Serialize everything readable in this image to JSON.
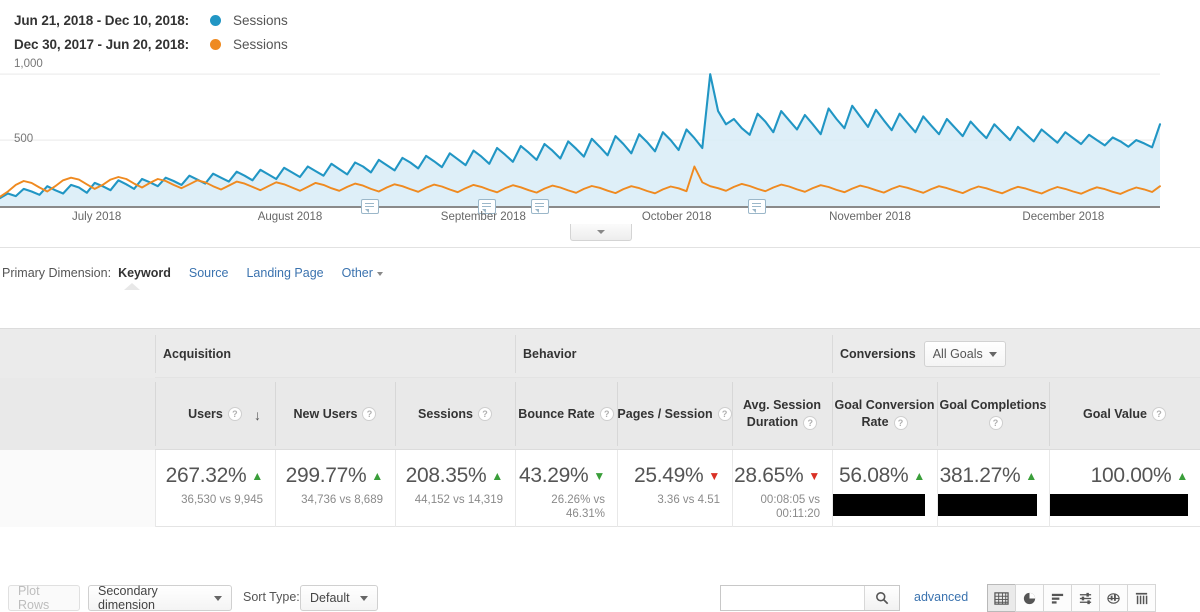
{
  "legend": {
    "rows": [
      {
        "range": "Jun 21, 2018 - Dec 10, 2018:",
        "metric": "Sessions",
        "color": "#2196c4"
      },
      {
        "range": "Dec 30, 2017 - Jun 20, 2018:",
        "metric": "Sessions",
        "color": "#ef8a20"
      }
    ]
  },
  "chart_data": {
    "type": "line",
    "title": "",
    "xlabel": "",
    "ylabel": "Sessions",
    "ylim": [
      0,
      1100
    ],
    "yticks": [
      "1,000",
      "500"
    ],
    "ytick_values": [
      1000,
      500
    ],
    "grid": true,
    "legend_position": "top-left",
    "categories": [
      "July 2018",
      "August 2018",
      "September 2018",
      "October 2018",
      "November 2018",
      "December 2018"
    ],
    "xtick_labels": [
      "July 2018",
      "August 2018",
      "September 2018",
      "October 2018",
      "November 2018",
      "December 2018"
    ],
    "annotations": [
      "annotation-marker",
      "annotation-marker",
      "annotation-marker",
      "annotation-marker"
    ],
    "series": [
      {
        "name": "Jun 21, 2018 - Dec 10, 2018 Sessions",
        "color": "#2196c4",
        "fill": "#d8ecf7",
        "values": [
          60,
          95,
          75,
          130,
          110,
          85,
          150,
          120,
          95,
          160,
          140,
          100,
          175,
          150,
          120,
          195,
          165,
          130,
          205,
          180,
          150,
          215,
          190,
          160,
          230,
          200,
          170,
          245,
          215,
          185,
          260,
          230,
          195,
          275,
          240,
          205,
          290,
          255,
          220,
          300,
          265,
          230,
          320,
          280,
          240,
          330,
          300,
          255,
          350,
          310,
          270,
          365,
          330,
          285,
          380,
          340,
          295,
          400,
          355,
          310,
          420,
          375,
          320,
          440,
          390,
          335,
          455,
          405,
          350,
          470,
          420,
          360,
          490,
          435,
          375,
          510,
          450,
          385,
          530,
          470,
          400,
          545,
          485,
          415,
          560,
          500,
          425,
          580,
          515,
          440,
          1000,
          720,
          620,
          660,
          590,
          540,
          700,
          640,
          560,
          720,
          650,
          580,
          690,
          620,
          545,
          740,
          660,
          590,
          760,
          680,
          600,
          730,
          650,
          575,
          700,
          630,
          560,
          680,
          610,
          545,
          660,
          595,
          530,
          640,
          575,
          515,
          620,
          560,
          500,
          600,
          545,
          490,
          580,
          530,
          480,
          560,
          515,
          470,
          540,
          500,
          460,
          520,
          490,
          450,
          500,
          475,
          445,
          620
        ]
      },
      {
        "name": "Dec 30, 2017 - Jun 20, 2018 Sessions",
        "color": "#ef8a20",
        "values": [
          70,
          110,
          160,
          190,
          175,
          140,
          110,
          150,
          195,
          215,
          200,
          165,
          130,
          160,
          200,
          220,
          205,
          170,
          140,
          175,
          205,
          190,
          160,
          135,
          165,
          195,
          180,
          150,
          125,
          155,
          185,
          170,
          145,
          120,
          150,
          180,
          165,
          140,
          115,
          145,
          175,
          160,
          135,
          115,
          145,
          170,
          155,
          130,
          110,
          140,
          165,
          150,
          128,
          108,
          138,
          162,
          148,
          125,
          105,
          135,
          160,
          145,
          122,
          104,
          134,
          158,
          142,
          120,
          102,
          132,
          155,
          140,
          118,
          100,
          130,
          152,
          138,
          116,
          98,
          128,
          150,
          136,
          114,
          96,
          126,
          148,
          134,
          112,
          300,
          180,
          150,
          135,
          115,
          145,
          168,
          152,
          130,
          112,
          140,
          162,
          148,
          126,
          108,
          136,
          158,
          144,
          122,
          105,
          132,
          155,
          140,
          120,
          102,
          130,
          152,
          138,
          118,
          100,
          128,
          150,
          136,
          116,
          98,
          126,
          148,
          134,
          114,
          96,
          124,
          146,
          132,
          112,
          95,
          122,
          144,
          130,
          110,
          93,
          120,
          142,
          128,
          108,
          92,
          118,
          140,
          126,
          106,
          150
        ]
      }
    ]
  },
  "primary_dimension": {
    "label": "Primary Dimension:",
    "current": "Keyword",
    "links": [
      "Source",
      "Landing Page"
    ],
    "other": "Other"
  },
  "toolbar": {
    "plot_rows": "Plot Rows",
    "secondary_dimension": "Secondary dimension",
    "sort_type_label": "Sort Type:",
    "sort_type_value": "Default",
    "search_value": "",
    "search_placeholder": "",
    "advanced": "advanced",
    "view_icons": [
      "table-view-icon",
      "pie-chart-view-icon",
      "bar-chart-view-icon",
      "performance-view-icon",
      "comparison-view-icon",
      "pivot-view-icon"
    ]
  },
  "table": {
    "groups": [
      {
        "label": "Acquisition"
      },
      {
        "label": "Behavior"
      },
      {
        "label": "Conversions",
        "dropdown": "All Goals"
      }
    ],
    "columns": [
      {
        "label": "Users",
        "help": "?",
        "sorted": true,
        "sort_dir": "↓"
      },
      {
        "label": "New Users",
        "help": "?"
      },
      {
        "label": "Sessions",
        "help": "?"
      },
      {
        "label": "Bounce Rate",
        "help": "?"
      },
      {
        "label": "Pages / Session",
        "help": "?"
      },
      {
        "label": "Avg. Session Duration",
        "help": "?"
      },
      {
        "label": "Goal Conversion Rate",
        "help": "?"
      },
      {
        "label": "Goal Completions",
        "help": "?"
      },
      {
        "label": "Goal Value",
        "help": "?"
      }
    ],
    "summary_row": [
      {
        "pct": "267.32%",
        "dir": "up",
        "sub": "36,530 vs 9,945",
        "redacted": false
      },
      {
        "pct": "299.77%",
        "dir": "up",
        "sub": "34,736 vs 8,689",
        "redacted": false
      },
      {
        "pct": "208.35%",
        "dir": "up",
        "sub": "44,152 vs 14,319",
        "redacted": false
      },
      {
        "pct": "43.29%",
        "dir": "down-good",
        "sub": "26.26% vs 46.31%",
        "redacted": false
      },
      {
        "pct": "25.49%",
        "dir": "down",
        "sub": "3.36 vs 4.51",
        "redacted": false
      },
      {
        "pct": "28.65%",
        "dir": "down",
        "sub": "00:08:05 vs 00:11:20",
        "redacted": false
      },
      {
        "pct": "56.08%",
        "dir": "up",
        "sub": "",
        "redacted": true
      },
      {
        "pct": "381.27%",
        "dir": "up",
        "sub": "",
        "redacted": true
      },
      {
        "pct": "100.00%",
        "dir": "up",
        "sub": "",
        "redacted": true
      }
    ]
  },
  "colors": {
    "series_blue": "#2196c4",
    "series_orange": "#ef8a20",
    "area_blue": "#d8ecf7",
    "link": "#3b73af",
    "up_green": "#3a9e3a",
    "down_red": "#d93025"
  }
}
